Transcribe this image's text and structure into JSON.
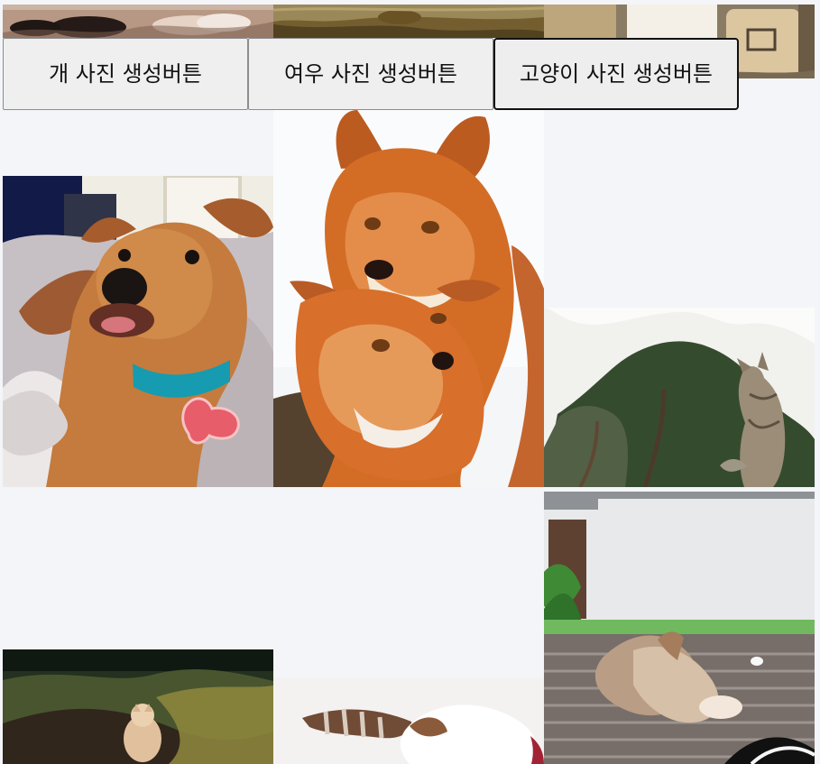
{
  "controls": {
    "buttons": [
      {
        "label": "개 사진 생성버튼"
      },
      {
        "label": "여우 사진 생성버튼"
      },
      {
        "label": "고양이 사진 생성버튼"
      }
    ]
  },
  "gallery": {
    "items": [
      {
        "animal": "dog"
      },
      {
        "animal": "fox"
      },
      {
        "animal": "cat"
      },
      {
        "animal": "dog"
      },
      {
        "animal": "fox"
      },
      {
        "animal": "cat"
      },
      {
        "animal": "dog"
      },
      {
        "animal": "fox"
      },
      {
        "animal": "cat"
      }
    ]
  },
  "colors": {
    "page_background": "#f4f5f9",
    "button_background": "#efefef",
    "button_border": "#8d8d8d",
    "active_button_border": "#111111"
  }
}
